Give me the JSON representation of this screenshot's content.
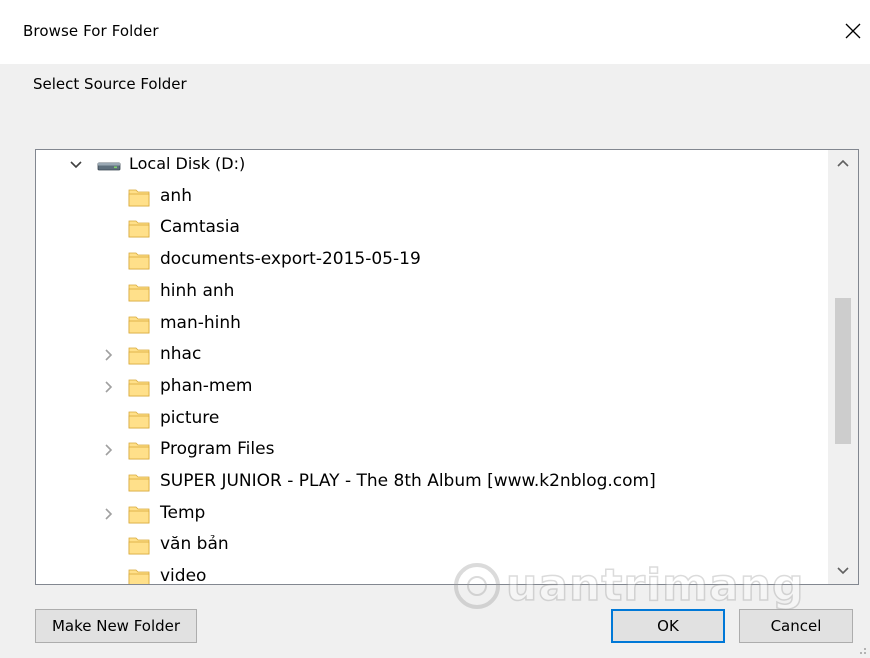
{
  "window": {
    "title": "Browse For Folder",
    "prompt": "Select Source Folder"
  },
  "tree": {
    "root": {
      "label": "Local Disk (D:)",
      "expanded": true,
      "icon": "drive-icon"
    },
    "items": [
      {
        "label": "anh",
        "has_children": false
      },
      {
        "label": "Camtasia",
        "has_children": false
      },
      {
        "label": "documents-export-2015-05-19",
        "has_children": false
      },
      {
        "label": "hinh anh",
        "has_children": false
      },
      {
        "label": "man-hinh",
        "has_children": false
      },
      {
        "label": "nhac",
        "has_children": true
      },
      {
        "label": "phan-mem",
        "has_children": true
      },
      {
        "label": "picture",
        "has_children": false
      },
      {
        "label": "Program Files",
        "has_children": true
      },
      {
        "label": "SUPER JUNIOR - PLAY - The 8th Album [www.k2nblog.com]",
        "has_children": false
      },
      {
        "label": "Temp",
        "has_children": true
      },
      {
        "label": "văn bản",
        "has_children": false
      },
      {
        "label": "video",
        "has_children": false
      }
    ]
  },
  "buttons": {
    "make_new_folder": "Make New Folder",
    "ok": "OK",
    "cancel": "Cancel"
  },
  "watermark": {
    "text": "uantrimang"
  },
  "colors": {
    "folder_fill": "#ffe08a",
    "folder_stroke": "#d9a93a",
    "focus_border": "#0078d7",
    "tree_border": "#828790"
  }
}
